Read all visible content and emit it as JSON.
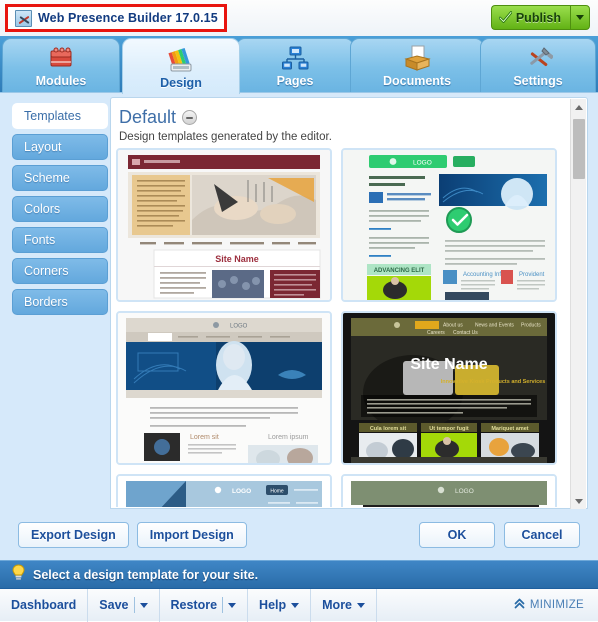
{
  "window": {
    "app_title": "Web Presence Builder 17.0.15",
    "app_icon": "app-builder-icon",
    "highlight_color": "#e8150f"
  },
  "publish": {
    "label": "Publish",
    "icon": "check-icon",
    "dropdown_icon": "caret-down-icon",
    "color": "#62b215"
  },
  "tabs": [
    {
      "label": "Modules",
      "icon": "blocks-icon",
      "active": false
    },
    {
      "label": "Design",
      "icon": "color-fan-icon",
      "active": true
    },
    {
      "label": "Pages",
      "icon": "sitemap-icon",
      "active": false
    },
    {
      "label": "Documents",
      "icon": "file-box-icon",
      "active": false
    },
    {
      "label": "Settings",
      "icon": "tools-icon",
      "active": false
    }
  ],
  "sidebar": {
    "items": [
      {
        "label": "Templates",
        "active": true
      },
      {
        "label": "Layout",
        "active": false
      },
      {
        "label": "Scheme",
        "active": false
      },
      {
        "label": "Colors",
        "active": false
      },
      {
        "label": "Fonts",
        "active": false
      },
      {
        "label": "Corners",
        "active": false
      },
      {
        "label": "Borders",
        "active": false
      }
    ]
  },
  "content": {
    "section_title": "Default",
    "collapse_icon": "minus-circle-icon",
    "section_subtitle": "Design templates generated by the editor.",
    "templates": [
      {
        "name": "maroon-drafting-template",
        "site_name": "Site Name",
        "accent": "#7b2733"
      },
      {
        "name": "green-business-template",
        "site_name": "LOGO",
        "accent": "#2ecc71"
      },
      {
        "name": "blue-corporate-template",
        "site_name": "LOGO",
        "accent": "#1a5c8f"
      },
      {
        "name": "dark-olive-template",
        "site_name": "Site Name",
        "accent": "#6d6a2a"
      },
      {
        "name": "sky-blue-template",
        "site_name": "LOGO",
        "accent": "#7fb3d5"
      },
      {
        "name": "sage-green-template",
        "site_name": "LOGO",
        "accent": "#7a8c6e"
      }
    ]
  },
  "scrollbar": {
    "up_icon": "triangle-up-icon",
    "down_icon": "triangle-down-icon"
  },
  "buttons": {
    "export_design": "Export Design",
    "import_design": "Import Design",
    "ok": "OK",
    "cancel": "Cancel"
  },
  "hintbar": {
    "icon": "lightbulb-icon",
    "text": "Select a design template for your site."
  },
  "toolbar": {
    "dashboard": "Dashboard",
    "save": "Save",
    "restore": "Restore",
    "help": "Help",
    "more": "More",
    "minimize": "MINIMIZE",
    "minimize_icon": "chevron-double-up-icon"
  }
}
